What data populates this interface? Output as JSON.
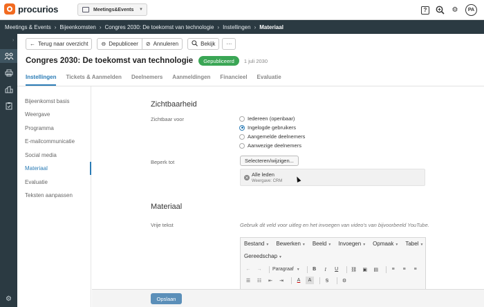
{
  "topbar": {
    "logo_text": "procurios",
    "app_selector": "Meetings&Events",
    "help_icon_glyph": "?",
    "avatar_initials": "PA"
  },
  "breadcrumb": [
    "Meetings & Events",
    "Bijeenkomsten",
    "Congres 2030: De toekomst van technologie",
    "Instellingen",
    "Materiaal"
  ],
  "toolbar": {
    "back_label": "Terug naar overzicht",
    "unpublish_label": "Depubliceer",
    "cancel_label": "Annuleren",
    "view_label": "Bekijk",
    "more_label": "···"
  },
  "header": {
    "title": "Congres 2030: De toekomst van technologie",
    "status": "Gepubliceerd",
    "date": "1 juli 2030"
  },
  "tabs": [
    "Instellingen",
    "Tickets & Aanmelden",
    "Deelnemers",
    "Aanmeldingen",
    "Financieel",
    "Evaluatie"
  ],
  "subnav": [
    "Bijeenkomst basis",
    "Weergave",
    "Programma",
    "E-mailcommunicatie",
    "Social media",
    "Materiaal",
    "Evaluatie",
    "Teksten aanpassen"
  ],
  "visibility": {
    "section_title": "Zichtbaarheid",
    "visible_label": "Zichtbaar voor",
    "options": [
      "Iedereen (openbaar)",
      "Ingelogde gebruikers",
      "Aangemelde deelnemers",
      "Aanwezige deelnemers"
    ],
    "selected_option": "Ingelogde gebruikers",
    "restrict_label": "Beperk tot",
    "select_button": "Selecteren/wijzigen...",
    "member_title": "Alle leden",
    "member_sub": "Weergave: CRM"
  },
  "material": {
    "section_title": "Materiaal",
    "free_text_label": "Vrije tekst",
    "hint": "Gebruik dit veld voor uitleg en het invoegen van video's van bijvoorbeeld YouTube.",
    "menus": [
      "Bestand",
      "Bewerken",
      "Beeld",
      "Invoegen",
      "Opmaak",
      "Tabel"
    ],
    "menus_row2": [
      "Gereedschap"
    ],
    "paragraph_select": "Paragraaf"
  },
  "footer": {
    "save_label": "Opslaan"
  },
  "colors": {
    "accent": "#2a7bb5",
    "nav_bg": "#2b3a42",
    "published": "#3aa655",
    "save": "#5b8fb9",
    "brand": "#f26b21"
  }
}
